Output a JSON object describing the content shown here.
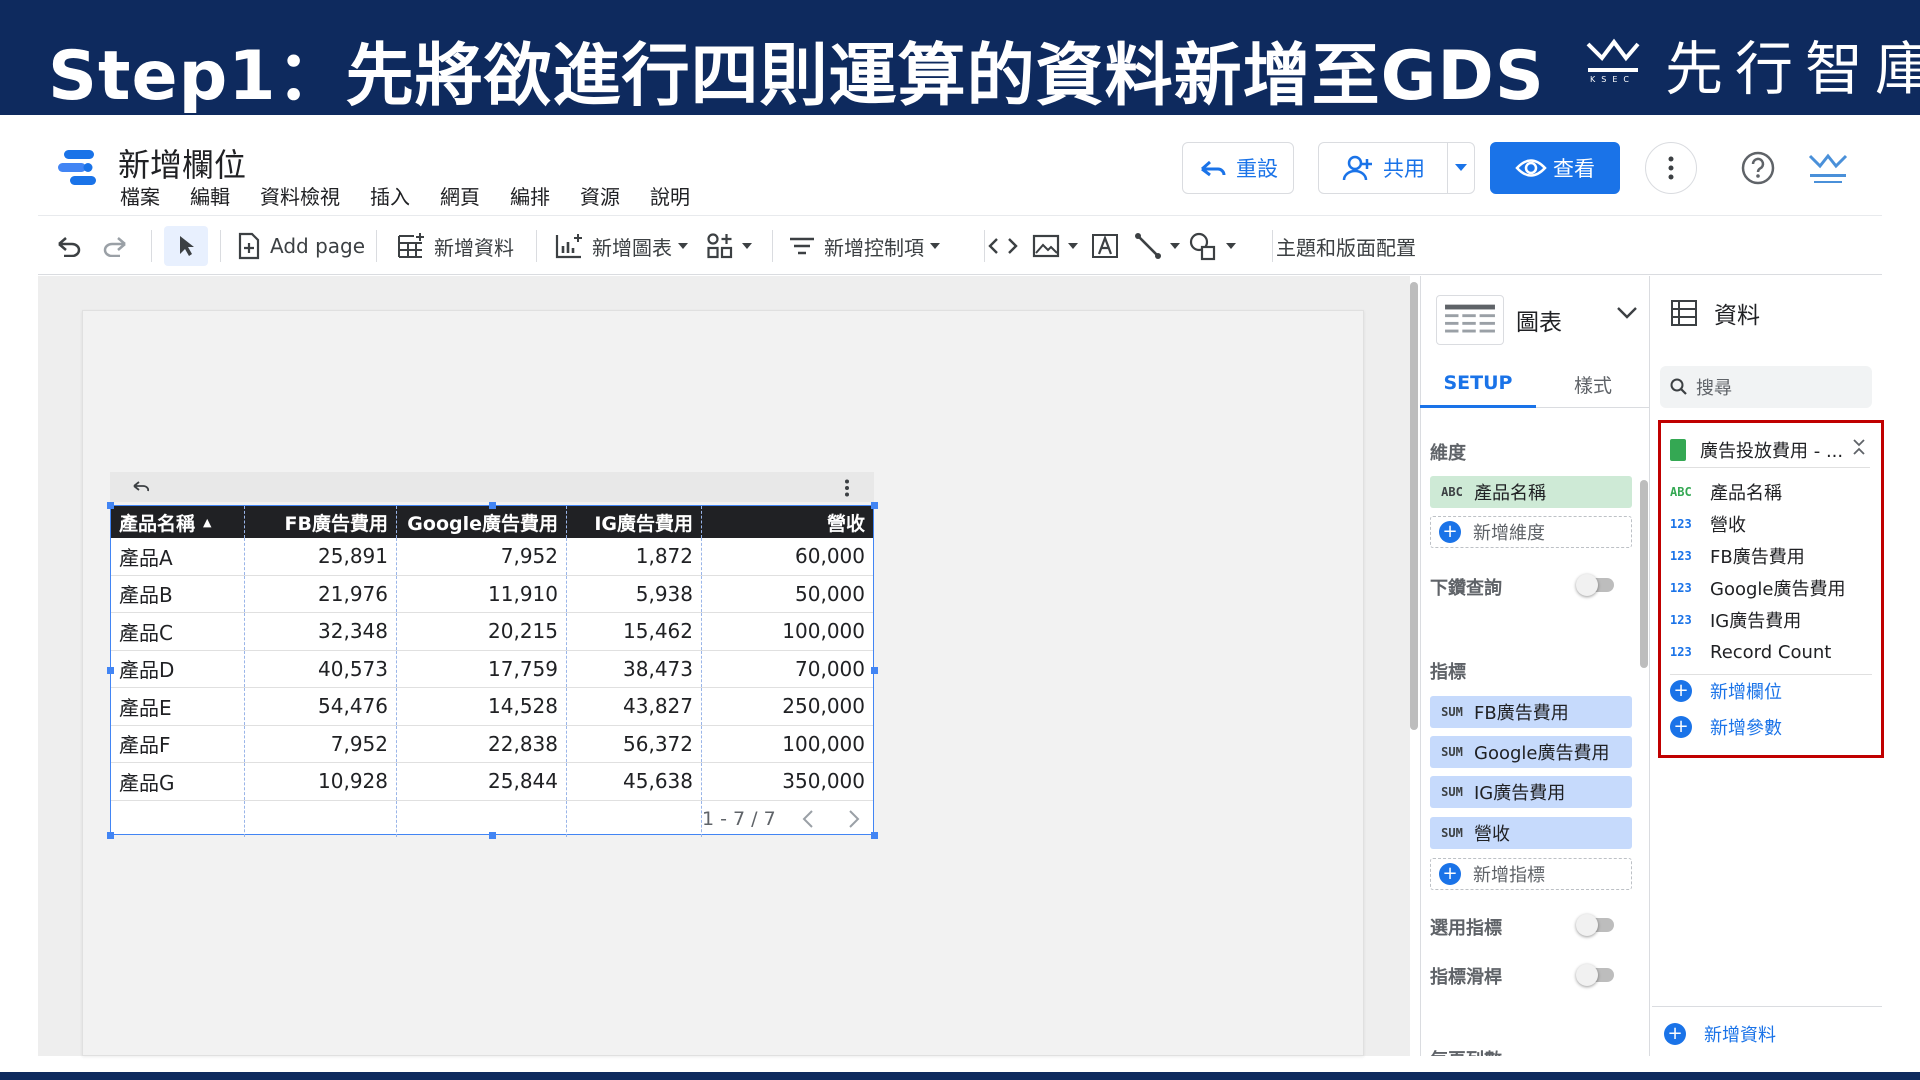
{
  "banner": {
    "title": "Step1：先將欲進行四則運算的資料新增至GDS",
    "brand_name": "先行智庫",
    "brand_icon": "ksec-mountain-icon"
  },
  "app": {
    "report_title": "新增欄位",
    "menu": [
      "檔案",
      "編輯",
      "資料檢視",
      "插入",
      "網頁",
      "編排",
      "資源",
      "說明"
    ],
    "header_buttons": {
      "reset": "重設",
      "share": "共用",
      "view": "查看"
    },
    "colors": {
      "accent": "#1a73e8",
      "banner": "#0e2a5e",
      "highlight": "#c00000"
    }
  },
  "toolbar": {
    "add_page": "Add page",
    "add_data": "新增資料",
    "add_chart": "新增圖表",
    "add_control": "新增控制項",
    "theme_layout": "主題和版面配置"
  },
  "table": {
    "columns": [
      "產品名稱",
      "FB廣告費用",
      "Google廣告費用",
      "IG廣告費用",
      "營收"
    ],
    "sort_indicator": "▲",
    "rows": [
      [
        "產品A",
        "25,891",
        "7,952",
        "1,872",
        "60,000"
      ],
      [
        "產品B",
        "21,976",
        "11,910",
        "5,938",
        "50,000"
      ],
      [
        "產品C",
        "32,348",
        "20,215",
        "15,462",
        "100,000"
      ],
      [
        "產品D",
        "40,573",
        "17,759",
        "38,473",
        "70,000"
      ],
      [
        "產品E",
        "54,476",
        "14,528",
        "43,827",
        "250,000"
      ],
      [
        "產品F",
        "7,952",
        "22,838",
        "56,372",
        "100,000"
      ],
      [
        "產品G",
        "10,928",
        "25,844",
        "45,638",
        "350,000"
      ]
    ],
    "pagination": "1 - 7 / 7"
  },
  "chart_panel": {
    "header": "圖表",
    "tabs": {
      "setup": "SETUP",
      "style": "樣式"
    },
    "dimension_label": "維度",
    "dimension": {
      "tag": "ABC",
      "name": "產品名稱"
    },
    "add_dimension": "新增維度",
    "drill_down": "下鑽查詢",
    "metric_label": "指標",
    "metrics": [
      {
        "tag": "SUM",
        "name": "FB廣告費用"
      },
      {
        "tag": "SUM",
        "name": "Google廣告費用"
      },
      {
        "tag": "SUM",
        "name": "IG廣告費用"
      },
      {
        "tag": "SUM",
        "name": "營收"
      }
    ],
    "add_metric": "新增指標",
    "optional_metrics": "選用指標",
    "metric_slider": "指標滑桿",
    "rows_per_page": "每頁列數"
  },
  "data_panel": {
    "header": "資料",
    "search_placeholder": "搜尋",
    "source_name": "廣告投放費用 - ...",
    "fields": [
      {
        "type": "ABC",
        "kind": "t",
        "name": "產品名稱"
      },
      {
        "type": "123",
        "kind": "n",
        "name": "營收"
      },
      {
        "type": "123",
        "kind": "n",
        "name": "FB廣告費用"
      },
      {
        "type": "123",
        "kind": "n",
        "name": "Google廣告費用"
      },
      {
        "type": "123",
        "kind": "n",
        "name": "IG廣告費用"
      },
      {
        "type": "123",
        "kind": "n",
        "name": "Record Count"
      }
    ],
    "add_field": "新增欄位",
    "add_parameter": "新增參數",
    "add_data": "新增資料"
  }
}
